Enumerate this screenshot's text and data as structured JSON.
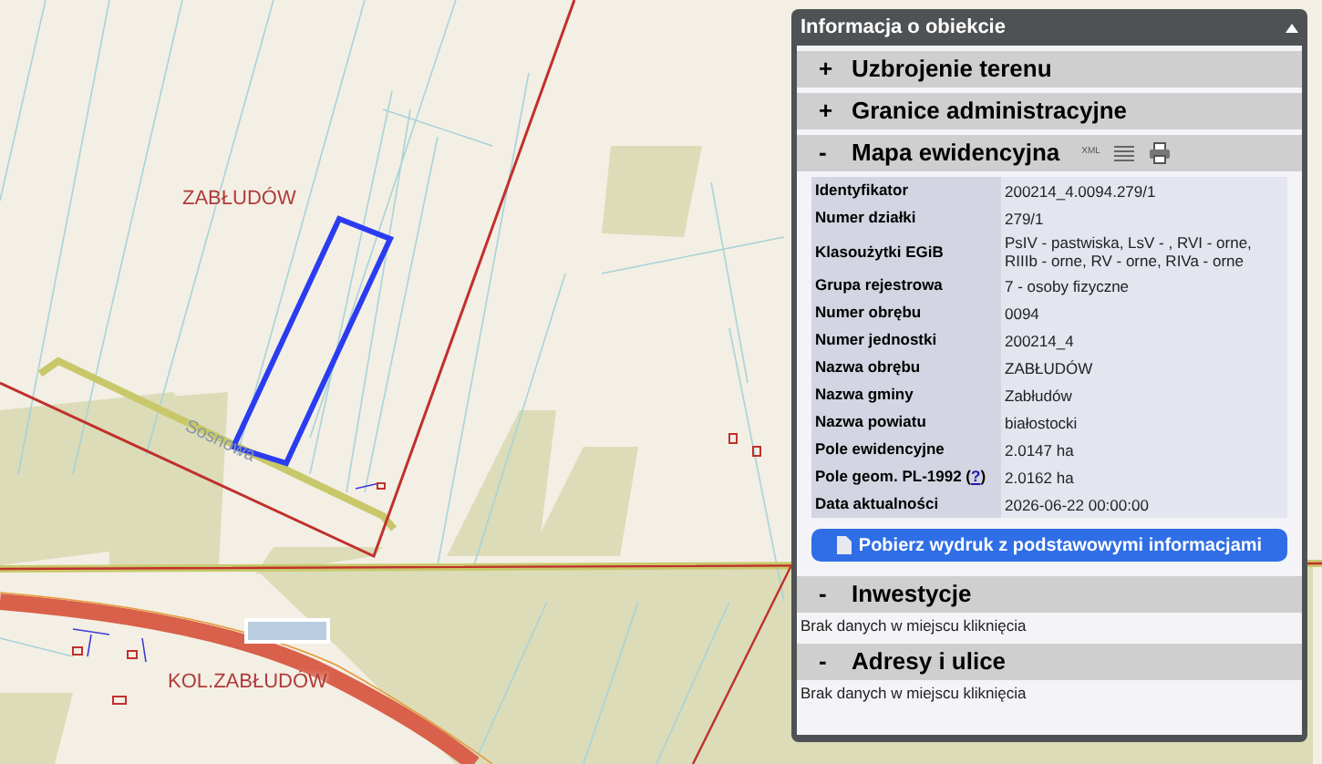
{
  "map": {
    "labels": [
      {
        "text": "ZABŁUDÓW",
        "kind": "area"
      },
      {
        "text": "Sosnowa",
        "kind": "street"
      },
      {
        "text": "KOL.ZABŁUDÓW",
        "kind": "area"
      }
    ]
  },
  "panel": {
    "title": "Informacja o obiekcie",
    "expanded": true,
    "sections": [
      {
        "sign": "+",
        "title": "Uzbrojenie terenu",
        "expanded": false
      },
      {
        "sign": "+",
        "title": "Granice administracyjne",
        "expanded": false
      },
      {
        "sign": "-",
        "title": "Mapa ewidencyjna",
        "expanded": true,
        "xml_label": "XML",
        "rows": [
          {
            "label": "Identyfikator",
            "value": "200214_4.0094.279/1"
          },
          {
            "label": "Numer działki",
            "value": "279/1"
          },
          {
            "label": "Klasoużytki EGiB",
            "value": "PsIV - pastwiska, LsV - , RVI - orne, RIIIb - orne, RV - orne, RIVa - orne"
          },
          {
            "label": "Grupa rejestrowa",
            "value": "7 - osoby fizyczne"
          },
          {
            "label": "Numer obrębu",
            "value": "0094"
          },
          {
            "label": "Numer jednostki",
            "value": "200214_4"
          },
          {
            "label": "Nazwa obrębu",
            "value": "ZABŁUDÓW"
          },
          {
            "label": "Nazwa gminy",
            "value": "Zabłudów"
          },
          {
            "label": "Nazwa powiatu",
            "value": "białostocki"
          },
          {
            "label": "Pole ewidencyjne",
            "value": "2.0147 ha"
          },
          {
            "label": "Pole geom. PL-1992 (",
            "help": "?",
            "help_close": ")",
            "value": "2.0162 ha"
          },
          {
            "label": "Data aktualności",
            "value": "2026-06-22 00:00:00"
          }
        ],
        "button": "Pobierz wydruk z podstawowymi informacjami"
      },
      {
        "sign": "-",
        "title": "Inwestycje",
        "expanded": true,
        "message": "Brak danych w miejscu kliknięcia"
      },
      {
        "sign": "-",
        "title": "Adresy i ulice",
        "expanded": true,
        "message": "Brak danych w miejscu kliknięcia"
      }
    ]
  }
}
